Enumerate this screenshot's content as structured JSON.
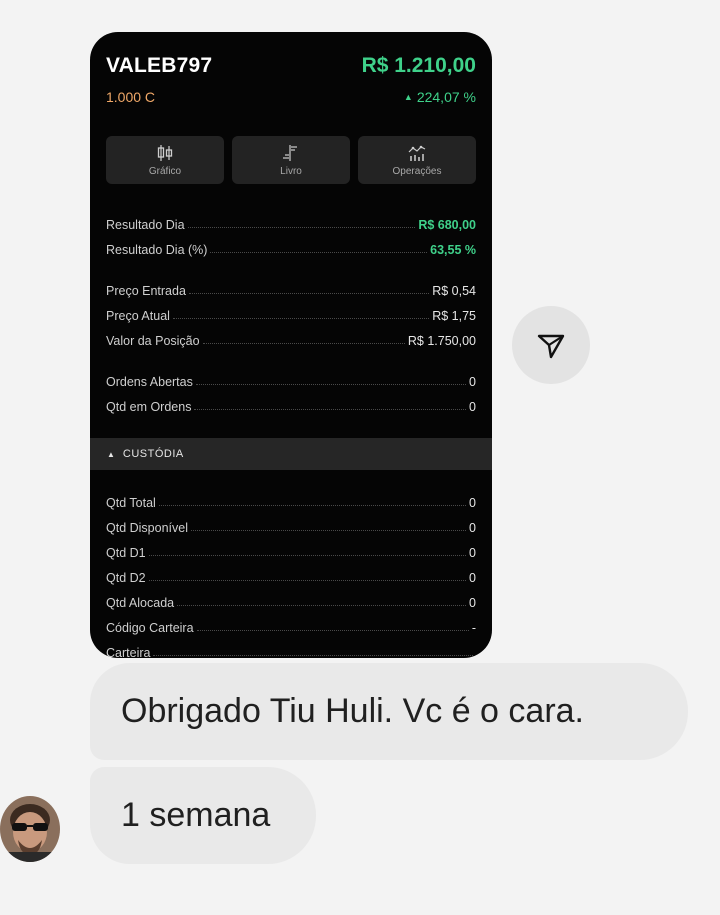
{
  "position_card": {
    "ticker": "VALEB797",
    "price": "R$ 1.210,00",
    "quantity": "1.000 C",
    "change": "224,07 %",
    "buttons": [
      {
        "label": "Gráfico",
        "icon": "candlestick-chart-icon"
      },
      {
        "label": "Livro",
        "icon": "order-book-icon"
      },
      {
        "label": "Operações",
        "icon": "operations-chart-icon"
      }
    ],
    "result_rows": [
      {
        "label": "Resultado Dia",
        "value": "R$ 680,00"
      },
      {
        "label": "Resultado Dia (%)",
        "value": "63,55 %"
      }
    ],
    "price_rows": [
      {
        "label": "Preço Entrada",
        "value": "R$ 0,54"
      },
      {
        "label": "Preço Atual",
        "value": "R$ 1,75"
      },
      {
        "label": "Valor da Posição",
        "value": "R$ 1.750,00"
      }
    ],
    "order_rows": [
      {
        "label": "Ordens Abertas",
        "value": "0"
      },
      {
        "label": "Qtd em Ordens",
        "value": "0"
      }
    ],
    "custody_section_title": "CUSTÓDIA",
    "custody_rows": [
      {
        "label": "Qtd Total",
        "value": "0"
      },
      {
        "label": "Qtd Disponível",
        "value": "0"
      },
      {
        "label": "Qtd D1",
        "value": "0"
      },
      {
        "label": "Qtd D2",
        "value": "0"
      },
      {
        "label": "Qtd Alocada",
        "value": "0"
      },
      {
        "label": "Código Carteira",
        "value": "-"
      },
      {
        "label": "Carteira",
        "value": ""
      }
    ],
    "colors": {
      "positive": "#3fd18a",
      "quantity": "#f0a868",
      "background": "#050505"
    }
  },
  "chat": {
    "send_icon": "paper-plane-icon",
    "messages": [
      {
        "text": "Obrigado Tiu Huli. Vc é o cara."
      },
      {
        "text": "1 semana"
      }
    ]
  }
}
